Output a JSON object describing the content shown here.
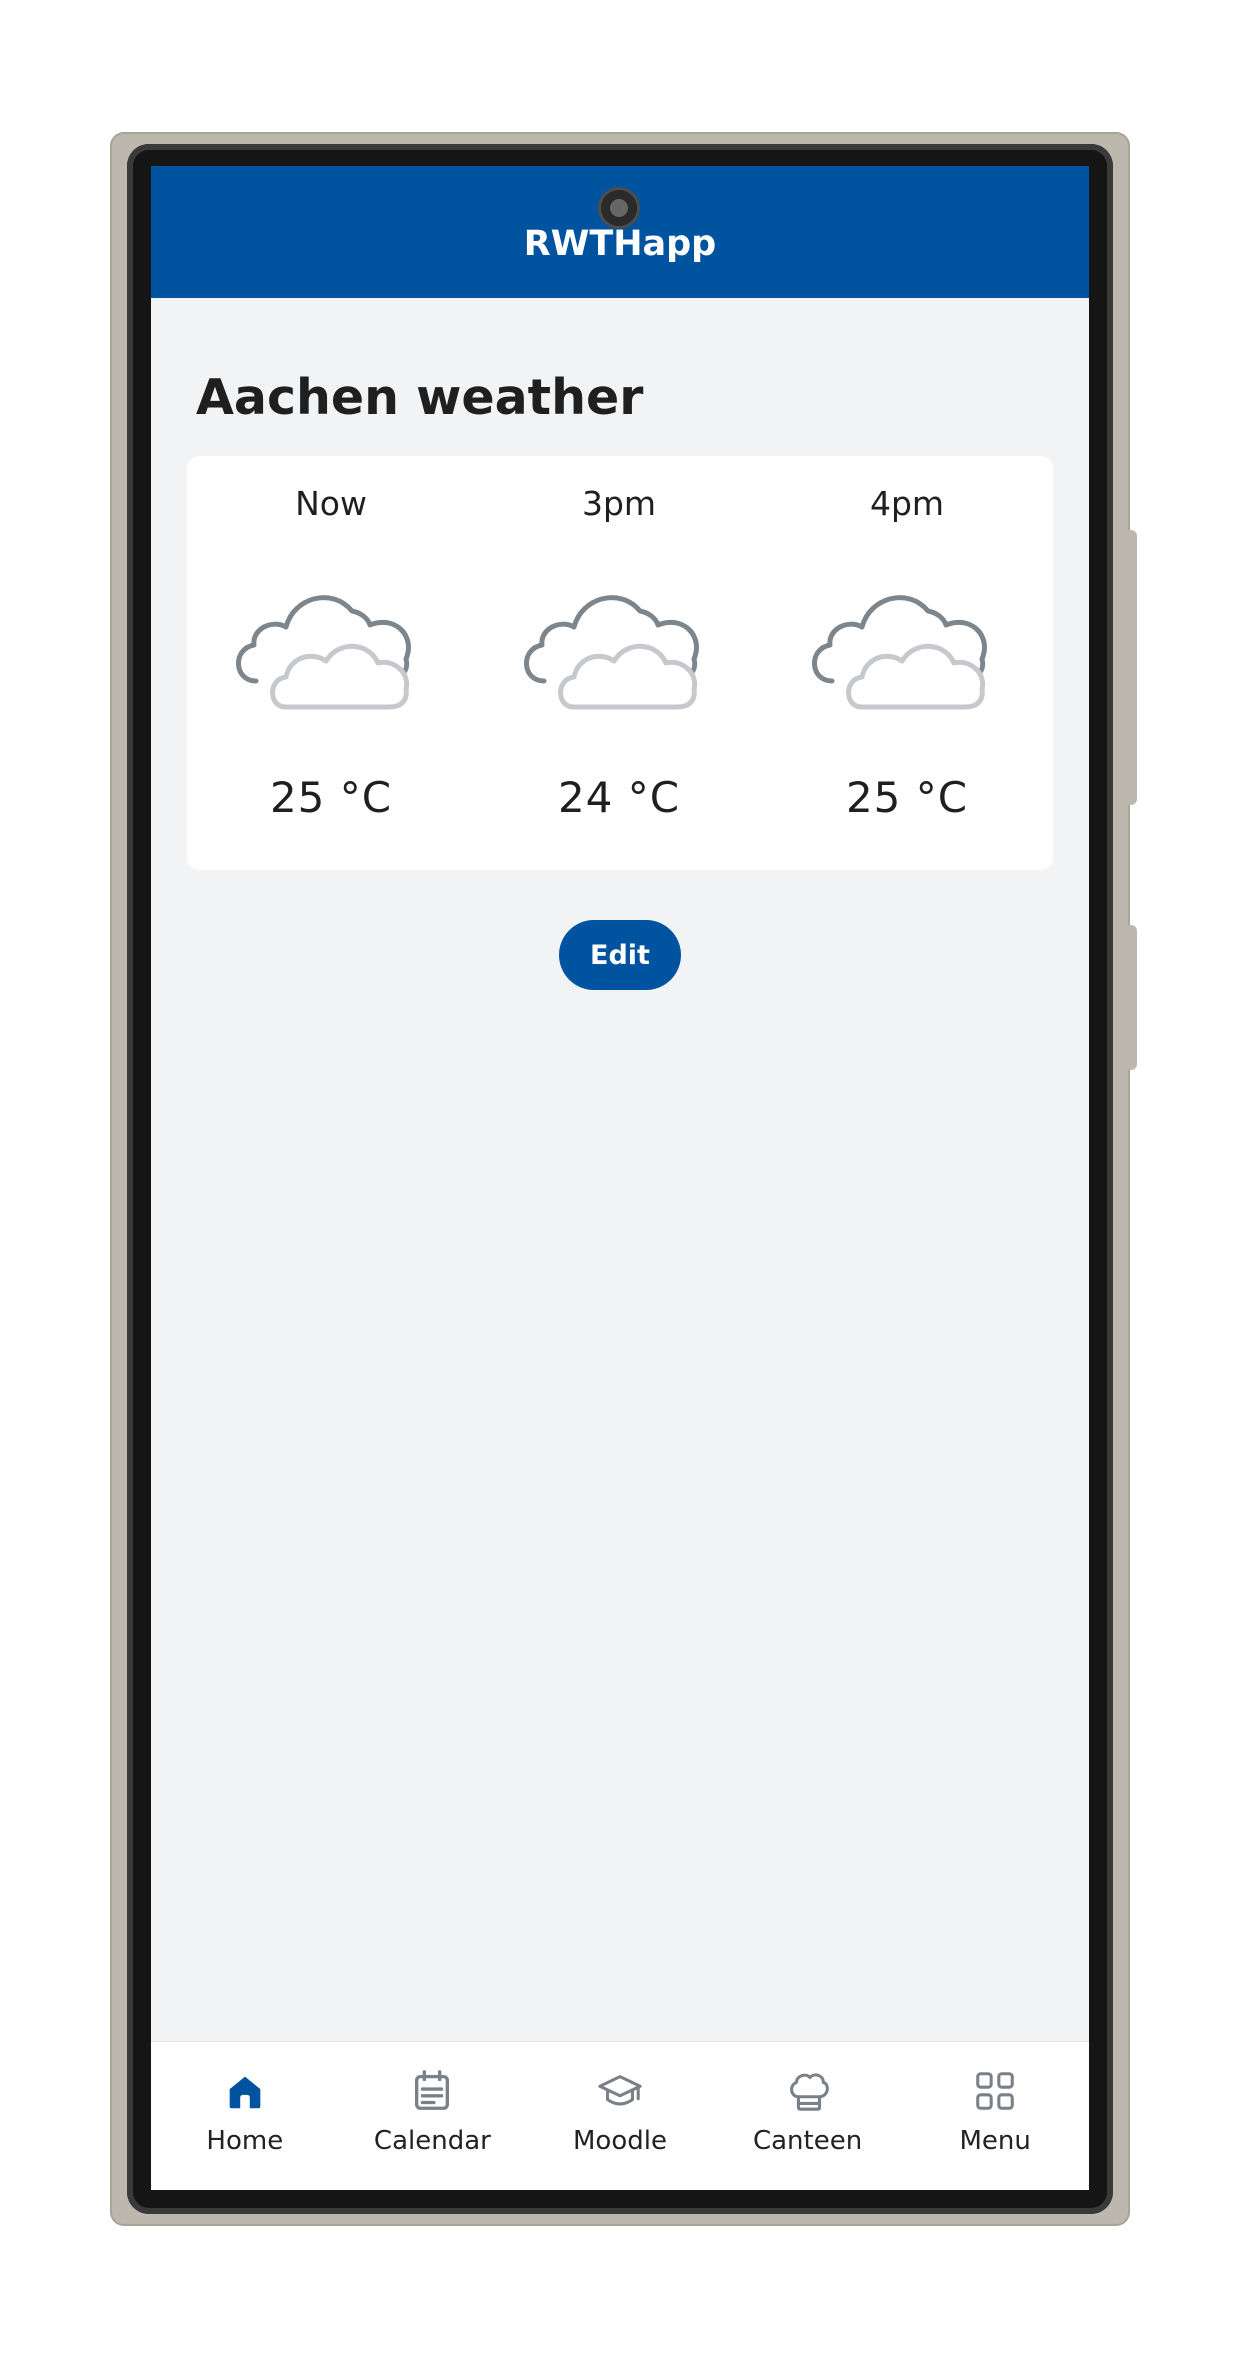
{
  "app": {
    "title": "RWTHapp"
  },
  "weather": {
    "title": "Aachen weather",
    "forecast": [
      {
        "time": "Now",
        "temp": "25 °C",
        "icon": "cloudy-icon"
      },
      {
        "time": "3pm",
        "temp": "24 °C",
        "icon": "cloudy-icon"
      },
      {
        "time": "4pm",
        "temp": "25 °C",
        "icon": "cloudy-icon"
      }
    ],
    "edit_label": "Edit"
  },
  "nav": {
    "items": [
      {
        "label": "Home",
        "icon": "home-icon",
        "active": true
      },
      {
        "label": "Calendar",
        "icon": "calendar-icon",
        "active": false
      },
      {
        "label": "Moodle",
        "icon": "graduation-cap-icon",
        "active": false
      },
      {
        "label": "Canteen",
        "icon": "chef-hat-icon",
        "active": false
      },
      {
        "label": "Menu",
        "icon": "grid-icon",
        "active": false
      }
    ]
  },
  "colors": {
    "brand": "#00549f",
    "icon_inactive": "#7a8088",
    "cloud_dark": "#7d858d",
    "cloud_light": "#c5c9cd"
  }
}
